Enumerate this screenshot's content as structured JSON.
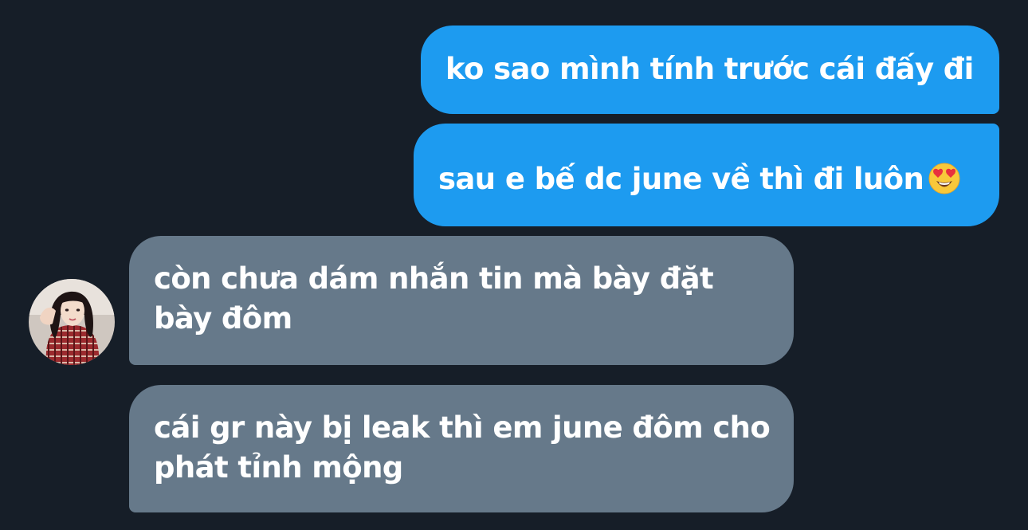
{
  "messages": [
    {
      "sender": "me",
      "text": "ko sao mình tính trước cái đấy đi"
    },
    {
      "sender": "me",
      "text": "sau e bế dc june về thì đi luôn",
      "emoji": "heart-eyes-emoji"
    },
    {
      "sender": "other",
      "lines": [
        "còn chưa dám nhắn tin mà bày đặt",
        "bày đôm"
      ]
    },
    {
      "sender": "other",
      "lines": [
        "cái gr này bị leak thì em june đôm cho",
        "phát tỉnh mộng"
      ]
    }
  ],
  "colors": {
    "background": "#161e28",
    "sent_bubble": "#1d9bf0",
    "received_bubble": "#66798a",
    "text": "#ffffff"
  }
}
